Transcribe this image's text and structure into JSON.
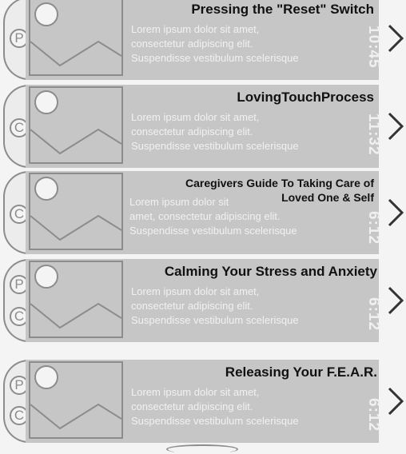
{
  "list": {
    "items": [
      {
        "title": "Pressing the \"Reset\" Switch",
        "desc_lines": [
          "Lorem ipsum dolor sit amet,",
          "consectetur adipiscing elit.",
          "Suspendisse vestibulum scelerisque"
        ],
        "time": "10:45",
        "badges": [
          "P"
        ]
      },
      {
        "title": "LovingTouchProcess",
        "desc_lines": [
          "Lorem ipsum dolor sit amet,",
          "consectetur adipiscing elit.",
          "Suspendisse vestibulum scelerisque"
        ],
        "time": "11:32",
        "badges": [
          "C"
        ]
      },
      {
        "title_lines": [
          "Caregivers Guide To Taking Care of",
          "Loved One & Self"
        ],
        "desc_lines": [
          "Lorem ipsum dolor sit",
          "amet, consectetur adipiscing elit.",
          "Suspendisse vestibulum scelerisque"
        ],
        "time": "6:12",
        "badges": [
          "C"
        ]
      },
      {
        "title": "Calming Your Stress and Anxiety",
        "desc_lines": [
          "Lorem ipsum dolor sit amet,",
          "consectetur adipiscing elit.",
          "Suspendisse vestibulum scelerisque"
        ],
        "time": "6:12",
        "badges": [
          "P",
          "C"
        ]
      },
      {
        "title": "Releasing Your F.E.A.R.",
        "desc_lines": [
          "Lorem ipsum dolor sit amet,",
          "consectetur adipiscing elit.",
          "Suspendisse vestibulum scelerisque"
        ],
        "time": "6:12",
        "badges": [
          "P",
          "C"
        ]
      }
    ]
  },
  "colors": {
    "panel": "#c6c6c6",
    "border": "#8c8c8c",
    "placeholder_text": "#f1f1f1"
  },
  "icons": {
    "thumbnail": "image-placeholder-icon",
    "chevron": "chevron-right-icon"
  }
}
